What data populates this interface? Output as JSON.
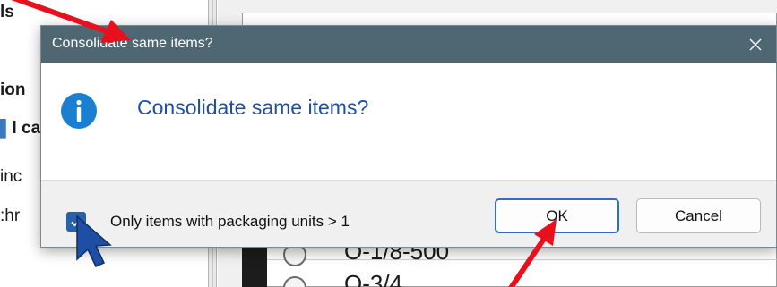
{
  "background": {
    "left_panel_fragments": [
      "ls",
      "ion",
      "l ca",
      "inc",
      ":hr"
    ],
    "right_rows": [
      "O-1/8-500",
      "O-3/4"
    ]
  },
  "dialog": {
    "title": "Consolidate same items?",
    "close_icon": "close-icon",
    "icon": "info-icon",
    "message": "Consolidate same items?",
    "checkbox_label": "Only items with packaging units > 1",
    "checkbox_checked": true,
    "ok_label": "OK",
    "cancel_label": "Cancel"
  },
  "annotations": {
    "arrow_color": "#e8101c",
    "cursor": "mouse-pointer-icon"
  },
  "colors": {
    "titlebar": "#4f6772",
    "message": "#1f4fa5",
    "info_icon": "#1a7fd0",
    "checkbox": "#2a5fa9"
  }
}
